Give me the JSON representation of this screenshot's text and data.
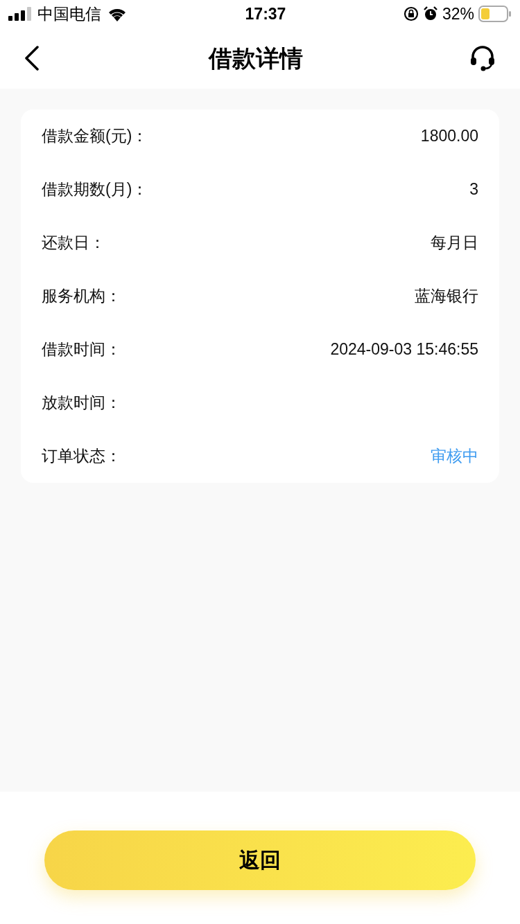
{
  "status_bar": {
    "carrier": "中国电信",
    "time": "17:37",
    "battery": "32%"
  },
  "nav": {
    "title": "借款详情"
  },
  "details": [
    {
      "label": "借款金额(元)：",
      "value": "1800.00",
      "kind": "plain"
    },
    {
      "label": "借款期数(月)：",
      "value": "3",
      "kind": "plain"
    },
    {
      "label": "还款日：",
      "value": "每月日",
      "kind": "plain"
    },
    {
      "label": "服务机构：",
      "value": "蓝海银行",
      "kind": "plain"
    },
    {
      "label": "借款时间：",
      "value": "2024-09-03 15:46:55",
      "kind": "plain"
    },
    {
      "label": "放款时间："
    },
    {
      "label": "订单状态：",
      "value": "审核中",
      "kind": "status"
    }
  ],
  "footer": {
    "button": "返回"
  }
}
